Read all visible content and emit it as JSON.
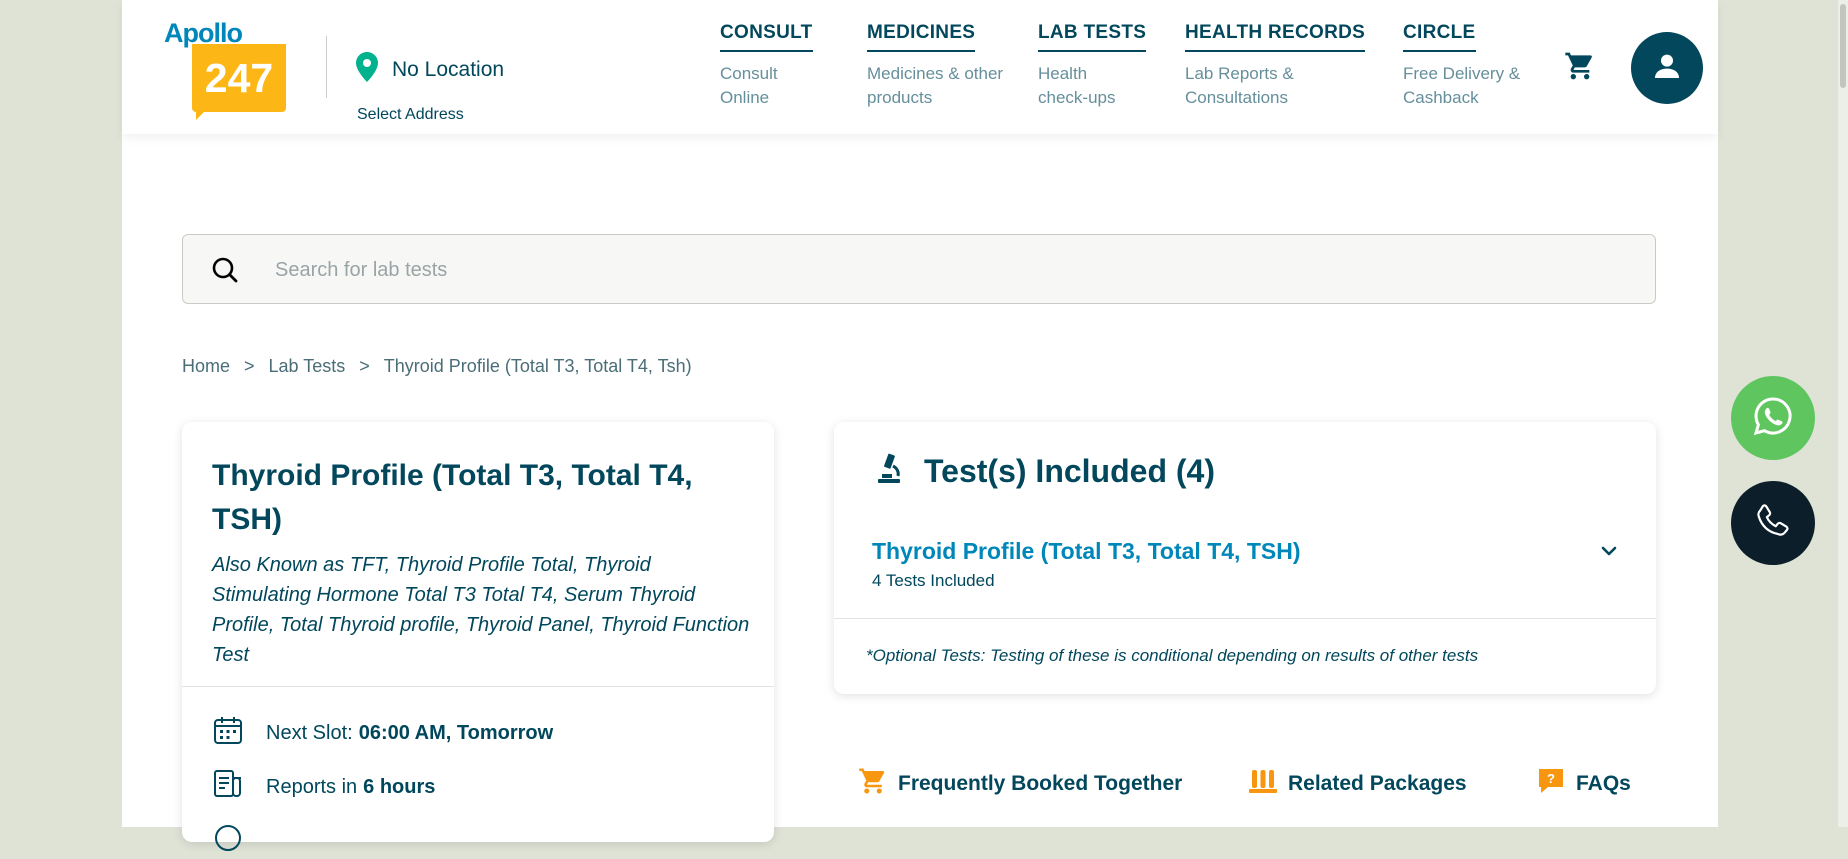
{
  "header": {
    "logo_apollo": "Apollo",
    "logo_247": "247",
    "location_label": "No Location",
    "select_address": "Select Address",
    "nav": [
      {
        "title": "CONSULT",
        "sub": "Consult Online"
      },
      {
        "title": "MEDICINES",
        "sub": "Medicines & other products"
      },
      {
        "title": "LAB TESTS",
        "sub": "Health check-ups"
      },
      {
        "title": "HEALTH RECORDS",
        "sub": "Lab Reports & Consultations"
      },
      {
        "title": "CIRCLE",
        "sub": "Free Delivery & Cashback"
      }
    ],
    "cart_icon": "cart-icon",
    "profile_icon": "user-icon"
  },
  "search": {
    "placeholder": "Search for lab tests"
  },
  "breadcrumb": {
    "home": "Home",
    "lab_tests": "Lab Tests",
    "current": "Thyroid Profile (Total T3, Total T4, Tsh)",
    "separator": ">"
  },
  "test": {
    "title": "Thyroid Profile (Total T3, Total T4, TSH)",
    "also_known": "Also Known as TFT, Thyroid Profile Total, Thyroid Stimulating Hormone Total T3 Total T4, Serum Thyroid Profile, Total Thyroid profile, Thyroid Panel, Thyroid Function Test",
    "next_slot_label": "Next Slot:",
    "next_slot_value": "06:00 AM, Tomorrow",
    "reports_label": "Reports in",
    "reports_value": "6 hours"
  },
  "included": {
    "title": "Test(s) Included (4)",
    "package_name": "Thyroid Profile (Total T3, Total T4, TSH)",
    "package_count": "4 Tests Included",
    "optional_note": "*Optional Tests: Testing of these is conditional depending on results of other tests"
  },
  "tabs": {
    "frequently": "Frequently Booked Together",
    "related": "Related Packages",
    "faqs": "FAQs"
  },
  "colors": {
    "primary": "#02475b",
    "accent_blue": "#0087ba",
    "logo_yellow": "#fcb716",
    "icon_orange": "#f8960f",
    "whatsapp_green": "#5fc55f",
    "call_dark": "#0b1e29"
  }
}
